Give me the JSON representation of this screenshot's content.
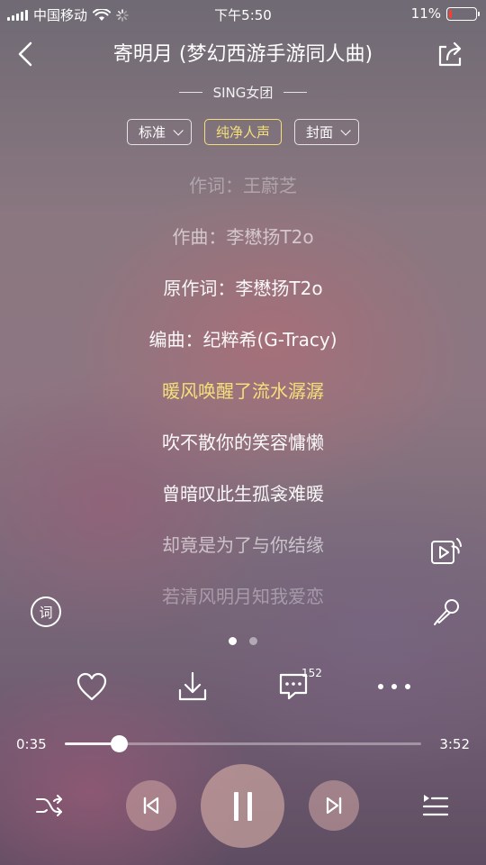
{
  "status_bar": {
    "carrier": "中国移动",
    "time": "下午5:50",
    "battery": "11%",
    "battery_level": 0.11
  },
  "header": {
    "title": "寄明月 (梦幻西游手游同人曲)",
    "artist": "SING女团"
  },
  "chips": [
    {
      "label": "标准",
      "has_dropdown": true,
      "active": false
    },
    {
      "label": "纯净人声",
      "has_dropdown": false,
      "active": true
    },
    {
      "label": "封面",
      "has_dropdown": true,
      "active": false
    }
  ],
  "lyrics": [
    {
      "text": "作词：王蔚芝",
      "state": "faded"
    },
    {
      "text": "作曲：李懋扬T2o",
      "state": "dim"
    },
    {
      "text": "原作词：李懋扬T2o",
      "state": "normal"
    },
    {
      "text": "编曲：纪粹希(G-Tracy)",
      "state": "normal"
    },
    {
      "text": "暖风唤醒了流水潺潺",
      "state": "current"
    },
    {
      "text": "吹不散你的笑容慵懒",
      "state": "normal"
    },
    {
      "text": "曾暗叹此生孤衾难暖",
      "state": "normal"
    },
    {
      "text": "却竟是为了与你结缘",
      "state": "dim"
    },
    {
      "text": "若清风明月知我爱恋",
      "state": "faded"
    }
  ],
  "side_icons": {
    "lyric_icon_label": "词"
  },
  "actions": {
    "comment_count": "152"
  },
  "player": {
    "elapsed": "0:35",
    "duration": "3:52",
    "progress": 0.151
  },
  "colors": {
    "highlight": "#f3e07a",
    "battery_low": "#ff3b30"
  }
}
